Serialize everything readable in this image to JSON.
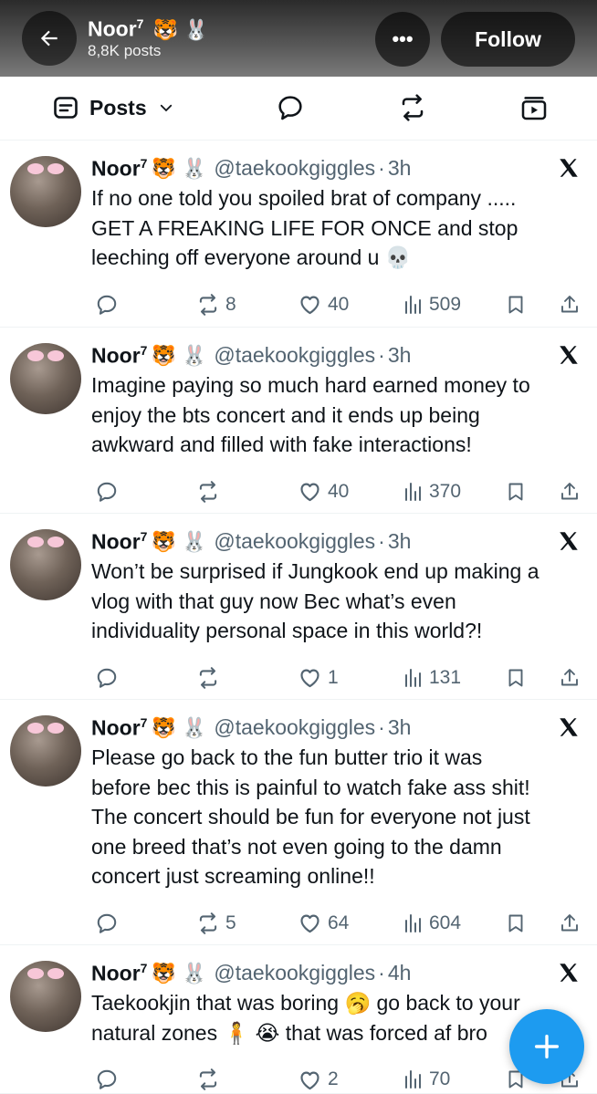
{
  "header": {
    "name": "Noor",
    "name_sup": "7",
    "name_emojis": "🐯 🐰",
    "posts_count": "8,8K posts",
    "more_label": "•••",
    "follow_label": "Follow"
  },
  "tabs": {
    "posts_label": "Posts"
  },
  "posts": [
    {
      "name": "Noor",
      "sup": "7",
      "emojis": "🐯 🐰",
      "handle": "@taekookgiggles",
      "dot": "·",
      "time": "3h",
      "text": "If no one told you spoiled brat of company .....\nGET A FREAKING LIFE FOR ONCE and stop\nleeching off everyone around u 💀",
      "reposts": "8",
      "likes": "40",
      "views": "509"
    },
    {
      "name": "Noor",
      "sup": "7",
      "emojis": "🐯 🐰",
      "handle": "@taekookgiggles",
      "dot": "·",
      "time": "3h",
      "text": "Imagine paying so much hard earned money to\nenjoy the bts concert and it ends up being\nawkward and filled with fake interactions!",
      "reposts": "",
      "likes": "40",
      "views": "370"
    },
    {
      "name": "Noor",
      "sup": "7",
      "emojis": "🐯 🐰",
      "handle": "@taekookgiggles",
      "dot": "·",
      "time": "3h",
      "text": "Won’t be surprised if Jungkook end up making a\nvlog with that guy now Bec what’s even\nindividuality personal space in this world?!",
      "reposts": "",
      "likes": "1",
      "views": "131"
    },
    {
      "name": "Noor",
      "sup": "7",
      "emojis": "🐯 🐰",
      "handle": "@taekookgiggles",
      "dot": "·",
      "time": "3h",
      "text": "Please go back to the fun butter trio it was\nbefore bec this is painful to watch fake ass shit!\nThe concert should be fun for everyone not just\none breed that’s not even going to the damn\nconcert just screaming online!!",
      "reposts": "5",
      "likes": "64",
      "views": "604"
    },
    {
      "name": "Noor",
      "sup": "7",
      "emojis": "🐯 🐰",
      "handle": "@taekookgiggles",
      "dot": "·",
      "time": "4h",
      "text": "Taekookjin that was boring 🥱 go back to your\nnatural zones 🧍 😭 that was forced af bro",
      "reposts": "",
      "likes": "2",
      "views": "70"
    }
  ],
  "fab": {
    "label": "+"
  },
  "colors": {
    "accent": "#1d9bf0",
    "text": "#0f1419",
    "muted": "#536471"
  }
}
